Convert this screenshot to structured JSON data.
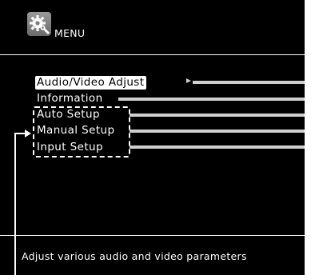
{
  "header": {
    "title": "MENU",
    "icon": "gear-wrench-icon"
  },
  "menu": {
    "items": [
      {
        "label": "Audio/Video Adjust",
        "selected": true
      },
      {
        "label": "Information",
        "selected": false
      },
      {
        "label": "Auto Setup",
        "selected": false
      },
      {
        "label": "Manual Setup",
        "selected": false
      },
      {
        "label": "Input Setup",
        "selected": false
      }
    ]
  },
  "footer": {
    "description": "Adjust various audio and video parameters"
  },
  "colors": {
    "background": "#000000",
    "text": "#ffffff",
    "connector": "#cfcfcf"
  }
}
